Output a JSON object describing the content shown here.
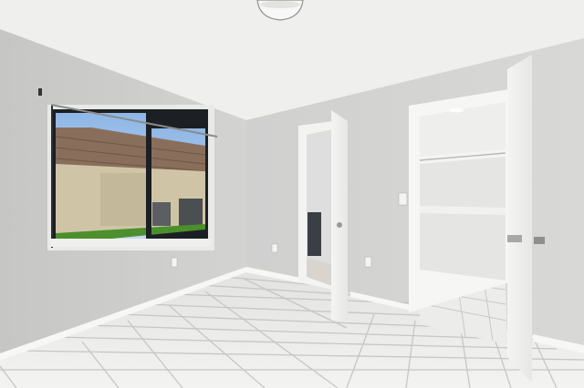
{
  "scene": {
    "kind": "photo",
    "subject": "empty-bedroom",
    "colors": {
      "ceiling": "#f1f1f0",
      "wall_left": "#cdcdcc",
      "wall_back": "#d4d4d3",
      "wall_right": "#cbcccb",
      "trim": "#f7f7f6",
      "floor": "#eeeeed",
      "grout": "#c4c4c2",
      "closet_shelf": "#f2f2f1",
      "window_frame": "#1b1f23",
      "window_sill": "#efefee",
      "stucco": "#cdc3a4",
      "roof": "#8a6e5c",
      "sky": "#a9c8ea",
      "lawn": "#4c8f2d",
      "vanity": "#3a3f45"
    },
    "icons": [
      "ceiling-light-icon",
      "light-switch-icon",
      "outlet-icon",
      "door-handle-icon"
    ]
  }
}
